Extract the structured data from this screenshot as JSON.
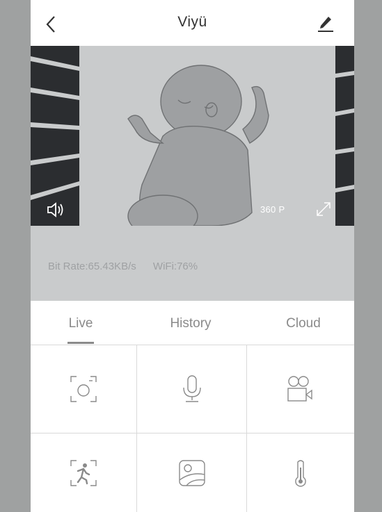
{
  "header": {
    "title": "Viyü",
    "back_icon": "chevron-left-icon",
    "edit_icon": "pencil-icon"
  },
  "video": {
    "resolution": "360 P",
    "speaker_icon": "speaker-icon",
    "fullscreen_icon": "fullscreen-icon"
  },
  "status": {
    "bit_rate": "Bit Rate:65.43KB/s",
    "wifi": "WiFi:76%"
  },
  "tabs": [
    {
      "label": "Live",
      "active": true
    },
    {
      "label": "History",
      "active": false
    },
    {
      "label": "Cloud",
      "active": false
    }
  ],
  "controls": [
    {
      "name": "snapshot-button",
      "icon": "camera-focus-icon"
    },
    {
      "name": "microphone-button",
      "icon": "microphone-icon"
    },
    {
      "name": "record-button",
      "icon": "video-camera-icon"
    },
    {
      "name": "motion-detection-button",
      "icon": "running-person-icon"
    },
    {
      "name": "album-button",
      "icon": "picture-icon"
    },
    {
      "name": "temperature-button",
      "icon": "thermometer-icon"
    }
  ],
  "colors": {
    "accent": "#8a8a8a",
    "background": "#9fa1a1",
    "video_bg": "#c9cbcc",
    "crib_dark": "#2b2d30"
  }
}
